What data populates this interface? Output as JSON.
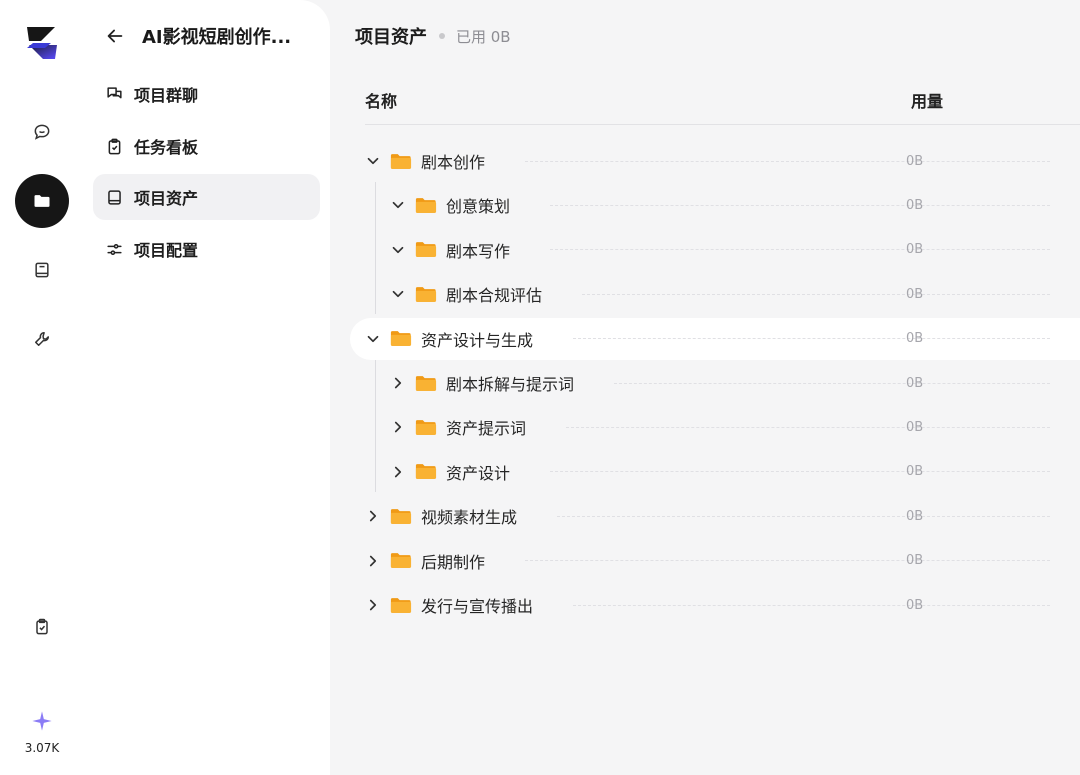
{
  "rail": {
    "credits_value": "3.07K"
  },
  "nav": {
    "project_title": "AI影视短剧创作...",
    "items": [
      {
        "label": "项目群聊",
        "icon": "chat-icon"
      },
      {
        "label": "任务看板",
        "icon": "clipboard-check-icon"
      },
      {
        "label": "项目资产",
        "icon": "book-icon",
        "active": true
      },
      {
        "label": "项目配置",
        "icon": "sliders-icon"
      }
    ]
  },
  "main": {
    "title": "项目资产",
    "usage_summary": "已用 0B",
    "columns": {
      "name": "名称",
      "usage": "用量"
    },
    "tree": [
      {
        "label": "剧本创作",
        "size": "0B",
        "level": 0,
        "expanded": true
      },
      {
        "label": "创意策划",
        "size": "0B",
        "level": 1,
        "expanded": true
      },
      {
        "label": "剧本写作",
        "size": "0B",
        "level": 1,
        "expanded": true
      },
      {
        "label": "剧本合规评估",
        "size": "0B",
        "level": 1,
        "expanded": true
      },
      {
        "label": "资产设计与生成",
        "size": "0B",
        "level": 0,
        "expanded": true,
        "hovered": true
      },
      {
        "label": "剧本拆解与提示词",
        "size": "0B",
        "level": 1,
        "expanded": false
      },
      {
        "label": "资产提示词",
        "size": "0B",
        "level": 1,
        "expanded": false
      },
      {
        "label": "资产设计",
        "size": "0B",
        "level": 1,
        "expanded": false
      },
      {
        "label": "视频素材生成",
        "size": "0B",
        "level": 0,
        "expanded": false
      },
      {
        "label": "后期制作",
        "size": "0B",
        "level": 0,
        "expanded": false
      },
      {
        "label": "发行与宣传播出",
        "size": "0B",
        "level": 0,
        "expanded": false
      }
    ]
  },
  "colors": {
    "folder": "#F9B233",
    "folder_dark": "#F09A16",
    "active_rail": "#161616",
    "spark": "#8B7CF6"
  }
}
